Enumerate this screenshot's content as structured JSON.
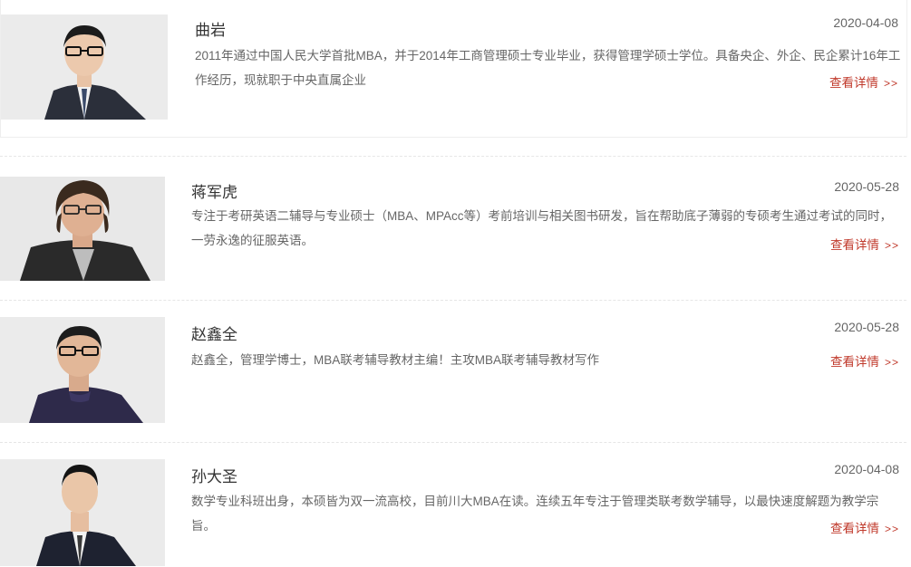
{
  "teachers": [
    {
      "name": "曲岩",
      "date": "2020-04-08",
      "description": "2011年通过中国人民大学首批MBA，并于2014年工商管理硕士专业毕业，获得管理学硕士学位。具备央企、外企、民企累计16年工作经历，现就职于中央直属企业",
      "more_label": "查看详情",
      "more_arrow": ">>"
    },
    {
      "name": "蒋军虎",
      "date": "2020-05-28",
      "description": "专注于考研英语二辅导与专业硕士（MBA、MPAcc等）考前培训与相关图书研发，旨在帮助底子薄弱的专硕考生通过考试的同时，一劳永逸的征服英语。",
      "more_label": "查看详情",
      "more_arrow": ">>"
    },
    {
      "name": "赵鑫全",
      "date": "2020-05-28",
      "description": "赵鑫全，管理学博士，MBA联考辅导教材主编！主攻MBA联考辅导教材写作",
      "more_label": "查看详情",
      "more_arrow": ">>"
    },
    {
      "name": "孙大圣",
      "date": "2020-04-08",
      "description": "数学专业科班出身，本硕皆为双一流高校，目前川大MBA在读。连续五年专注于管理类联考数学辅导，以最快速度解题为教学宗旨。",
      "more_label": "查看详情",
      "more_arrow": ">>"
    }
  ],
  "colors": {
    "link": "#c0392b",
    "photo_bg": "#ebebeb",
    "text": "#666666"
  }
}
